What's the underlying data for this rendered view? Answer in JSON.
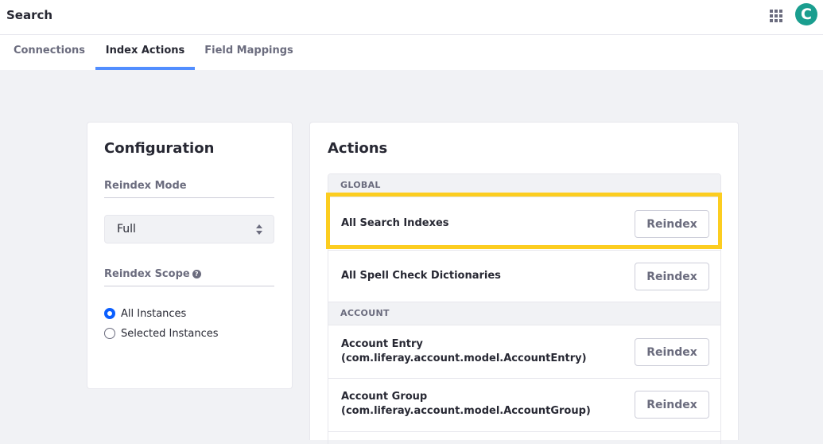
{
  "header": {
    "title": "Search",
    "apps_icon": "apps-grid-icon",
    "avatar_letter": "C",
    "avatar_color": "#1a9e8f"
  },
  "tabs": [
    {
      "label": "Connections",
      "active": false
    },
    {
      "label": "Index Actions",
      "active": true
    },
    {
      "label": "Field Mappings",
      "active": false
    }
  ],
  "configuration": {
    "title": "Configuration",
    "reindex_mode_label": "Reindex Mode",
    "reindex_mode_value": "Full",
    "reindex_scope_label": "Reindex Scope",
    "help_icon": "?",
    "scope_options": [
      {
        "label": "All Instances",
        "checked": true
      },
      {
        "label": "Selected Instances",
        "checked": false
      }
    ]
  },
  "actions": {
    "title": "Actions",
    "groups": [
      {
        "name": "GLOBAL",
        "items": [
          {
            "label": "All Search Indexes",
            "button": "Reindex",
            "highlighted": true
          },
          {
            "label": "All Spell Check Dictionaries",
            "button": "Reindex"
          }
        ]
      },
      {
        "name": "ACCOUNT",
        "items": [
          {
            "label_line1": "Account Entry",
            "label_line2": "(com.liferay.account.model.AccountEntry)",
            "button": "Reindex"
          },
          {
            "label_line1": "Account Group",
            "label_line2": "(com.liferay.account.model.AccountGroup)",
            "button": "Reindex"
          }
        ]
      }
    ]
  },
  "colors": {
    "accent": "#528eff",
    "highlight": "#fccd20",
    "radio_checked": "#0b5fff"
  }
}
